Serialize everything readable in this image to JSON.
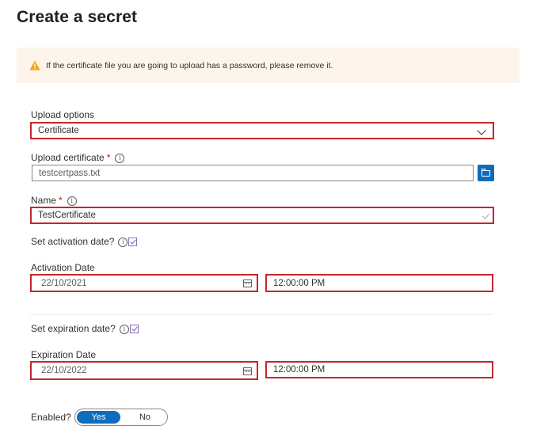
{
  "page": {
    "title": "Create a secret"
  },
  "warning": {
    "icon": "warning-icon",
    "text": "If the certificate file you are going to upload has a password, please remove it."
  },
  "upload_options": {
    "label": "Upload options",
    "value": "Certificate"
  },
  "upload_certificate": {
    "label": "Upload certificate",
    "required_mark": "*",
    "value": "testcertpass.txt"
  },
  "name": {
    "label": "Name",
    "required_mark": "*",
    "value": "TestCertificate"
  },
  "activation": {
    "checkbox_label": "Set activation date?",
    "checked": true,
    "date_label": "Activation Date",
    "date": "22/10/2021",
    "time": "12:00:00 PM"
  },
  "expiration": {
    "checkbox_label": "Set expiration date?",
    "checked": true,
    "date_label": "Expiration Date",
    "date": "22/10/2022",
    "time": "12:00:00 PM"
  },
  "enabled": {
    "label": "Enabled?",
    "on_label": "Yes",
    "off_label": "No",
    "selected": "Yes"
  },
  "colors": {
    "accent": "#0f6cbd",
    "highlight": "#c4262e",
    "warning_bg": "#fdf4ec",
    "warning_icon": "#f7a400"
  }
}
